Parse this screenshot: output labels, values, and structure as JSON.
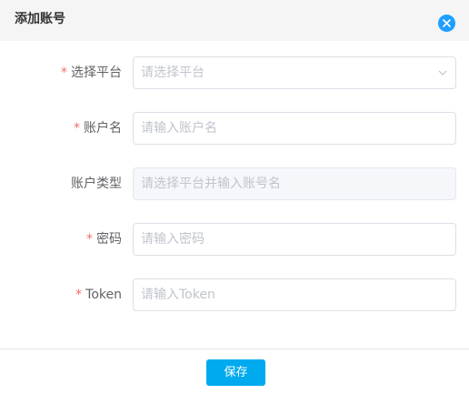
{
  "dialog": {
    "title": "添加账号",
    "close_icon": "close-icon"
  },
  "form": {
    "platform": {
      "required": "*",
      "label": "选择平台",
      "placeholder": "请选择平台",
      "icon": "chevron-down-icon"
    },
    "account_name": {
      "required": "*",
      "label": "账户名",
      "placeholder": "请输入账户名"
    },
    "account_type": {
      "label": "账户类型",
      "placeholder": "请选择平台并输入账号名"
    },
    "password": {
      "required": "*",
      "label": "密码",
      "placeholder": "请输入密码"
    },
    "token": {
      "required": "*",
      "label": "Token",
      "placeholder": "请输入Token"
    }
  },
  "footer": {
    "save_label": "保存"
  },
  "colors": {
    "accent": "#1e9fff",
    "save_button": "#00aaee",
    "required": "#f56c6c"
  }
}
